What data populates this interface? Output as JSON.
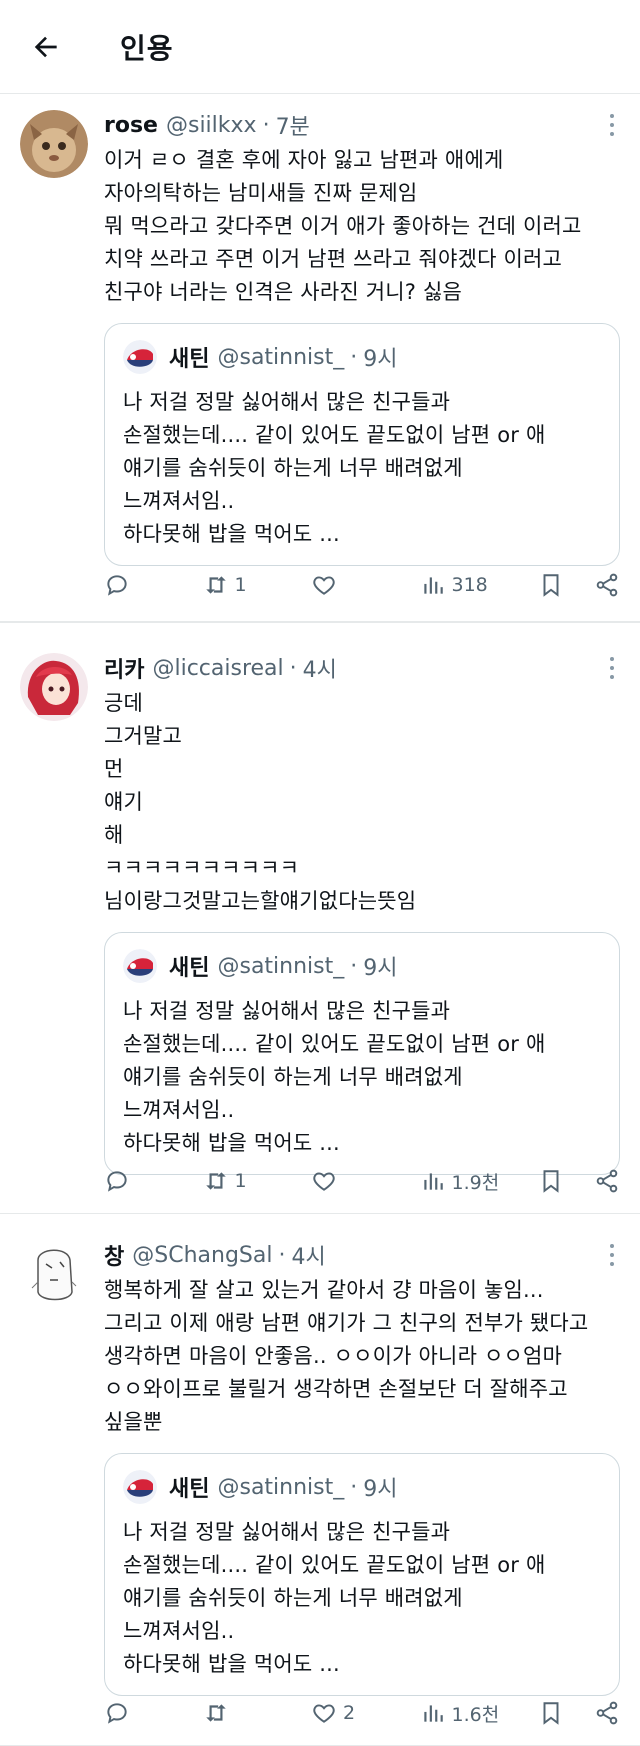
{
  "header": {
    "title": "인용"
  },
  "quoted": {
    "name": "새틴",
    "handle": "@satinnist_",
    "time": "9시",
    "text": "나 저걸 정말 싫어해서 많은 친구들과\n손절했는데.... 같이 있어도 끝도없이 남편 or 애\n얘기를 숨쉬듯이 하는게 너무 배려없게\n느껴져서임..\n하다못해 밥을 먹어도 ..."
  },
  "tweets": [
    {
      "name": "rose",
      "handle": "@siilkxx",
      "time": "7분",
      "text": "이거 ㄹㅇ 결혼 후에 자아 잃고 남편과 애에게\n자아의탁하는 남미새들 진짜 문제임\n뭐 먹으라고 갖다주면 이거 애가 좋아하는 건데 이러고\n치약 쓰라고 주면 이거 남편 쓰라고 줘야겠다 이러고\n친구야 너라는 인격은 사라진 거니? 싫음",
      "retweets": "1",
      "likes": "",
      "views": "318"
    },
    {
      "name": "리카",
      "handle": "@liccaisreal",
      "time": "4시",
      "text": "긍데\n그거말고\n먼\n얘기\n해\nㅋㅋㅋㅋㅋㅋㅋㅋㅋㅋ\n님이랑그것말고는할얘기없다는뜻임",
      "retweets": "1",
      "likes": "",
      "views": "1.9천"
    },
    {
      "name": "창",
      "handle": "@SChangSal",
      "time": "4시",
      "text": "행복하게 잘 살고 있는거 같아서 걍 마음이 놓임...\n그리고 이제 애랑 남편 얘기가 그 친구의 전부가 됐다고\n생각하면 마음이 안좋음.. ㅇㅇ이가 아니라 ㅇㅇ엄마\nㅇㅇ와이프로 불릴거 생각하면 손절보단 더 잘해주고\n싶을뿐",
      "retweets": "",
      "likes": "2",
      "views": "1.6천"
    }
  ]
}
